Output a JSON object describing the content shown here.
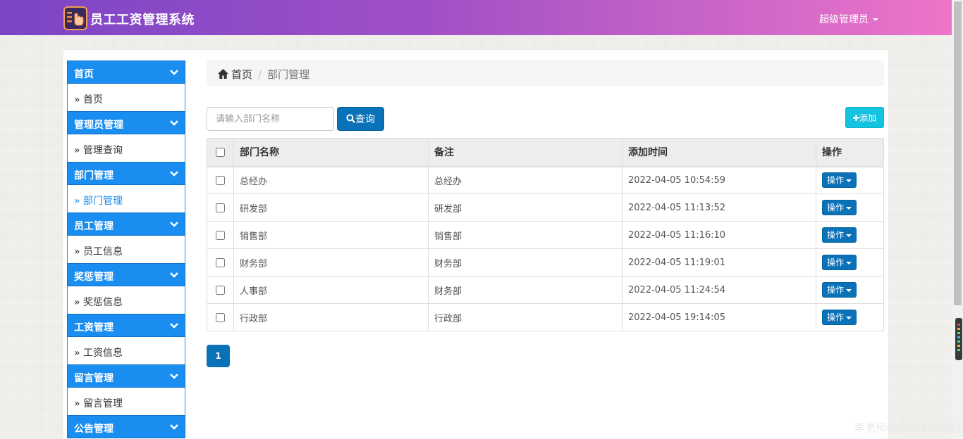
{
  "app": {
    "title": "员工工资管理系统",
    "user_menu": "超级管理员"
  },
  "sidebar": {
    "groups": [
      {
        "title": "首页",
        "items": [
          "首页"
        ]
      },
      {
        "title": "管理员管理",
        "items": [
          "管理查询"
        ]
      },
      {
        "title": "部门管理",
        "items": [
          "部门管理"
        ]
      },
      {
        "title": "员工管理",
        "items": [
          "员工信息"
        ]
      },
      {
        "title": "奖惩管理",
        "items": [
          "奖惩信息"
        ]
      },
      {
        "title": "工资管理",
        "items": [
          "工资信息"
        ]
      },
      {
        "title": "留言管理",
        "items": [
          "留言管理"
        ]
      },
      {
        "title": "公告管理",
        "items": []
      }
    ],
    "active_item": "部门管理"
  },
  "breadcrumb": {
    "home": "首页",
    "current": "部门管理"
  },
  "toolbar": {
    "search_placeholder": "请输入部门名称",
    "query_label": "查询",
    "add_label": "添加"
  },
  "table": {
    "columns": [
      "部门名称",
      "备注",
      "添加时间",
      "操作"
    ],
    "rows": [
      {
        "name": "总经办",
        "note": "总经办",
        "time": "2022-04-05 10:54:59",
        "action": "操作"
      },
      {
        "name": "研发部",
        "note": "研发部",
        "time": "2022-04-05 11:13:52",
        "action": "操作"
      },
      {
        "name": "销售部",
        "note": "销售部",
        "time": "2022-04-05 11:16:10",
        "action": "操作"
      },
      {
        "name": "财务部",
        "note": "财务部",
        "time": "2022-04-05 11:19:01",
        "action": "操作"
      },
      {
        "name": "人事部",
        "note": "财务部",
        "time": "2022-04-05 11:24:54",
        "action": "操作"
      },
      {
        "name": "行政部",
        "note": "行政部",
        "time": "2022-04-05 19:14:05",
        "action": "操作"
      }
    ]
  },
  "pagination": {
    "current": "1"
  },
  "watermark": "李老师qq857222631",
  "colors": {
    "accent": "#1a8df0",
    "primary_btn": "#0a72b8",
    "add_btn": "#14c3e0"
  }
}
